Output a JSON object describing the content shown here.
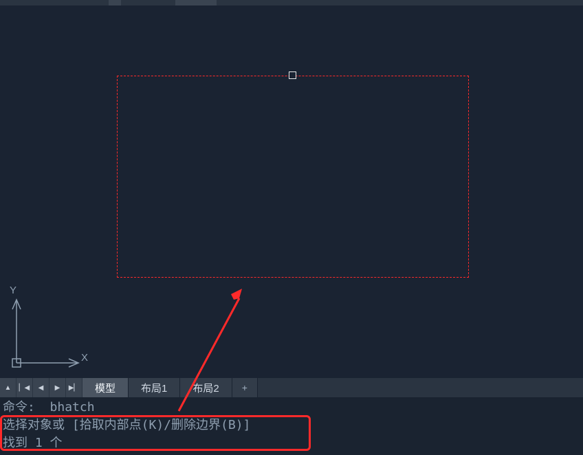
{
  "tabs": {
    "model": "模型",
    "layout1": "布局1",
    "layout2": "布局2",
    "plus": "+"
  },
  "nav": {
    "up": "▲",
    "first": "▏◀",
    "prev": "◀",
    "next": "▶",
    "last": "▶▏"
  },
  "ucs": {
    "x": "X",
    "y": "Y"
  },
  "cmd": {
    "line1_prefix": "命令:  ",
    "line1_cmd": "bhatch",
    "line2": "选择对象或 [拾取内部点(K)/删除边界(B)]",
    "line3": "找到 1 个"
  }
}
